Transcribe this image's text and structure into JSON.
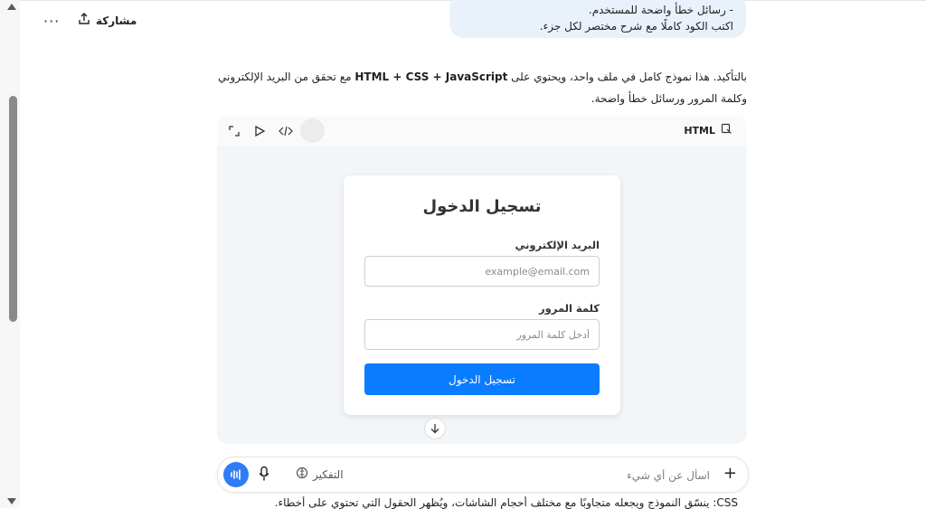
{
  "header": {
    "share_label": "مشاركة",
    "more_label": "···"
  },
  "user_message": {
    "line1": "- رسائل خطأ واضحة للمستخدم.",
    "line2": "اكتب الكود كاملًا مع شرح مختصر لكل جزء."
  },
  "assistant": {
    "intro_part1": "بالتأكيد. هذا نموذج كامل في ملف واحد، ويحتوي على ",
    "intro_tech": "HTML + CSS + JavaScript",
    "intro_part2": " مع تحقق من البريد الإلكتروني وكلمة المرور ورسائل خطأ واضحة."
  },
  "code_card": {
    "language_label": "HTML"
  },
  "login_form": {
    "title": "تسجيل الدخول",
    "email_label": "البريد الإلكتروني",
    "email_placeholder": "example@email.com",
    "password_label": "كلمة المرور",
    "password_placeholder": "أدخل كلمة المرور",
    "submit_label": "تسجيل الدخول"
  },
  "partial_list": {
    "bullet_text": "CSS: ينسّق النموذج ويجعله متجاوبًا مع مختلف أحجام الشاشات، ويُظهر الحقول التي تحتوي على أخطاء."
  },
  "composer": {
    "placeholder": "اسأل عن أي شيء",
    "think_label": "التفكير",
    "plus_label": "+"
  },
  "icons": {
    "share": "share-icon",
    "expand": "expand-icon",
    "play": "play-icon",
    "code": "code-icon",
    "copy": "copy-icon",
    "arrow_down": "arrow-down-icon",
    "mic": "mic-icon",
    "voice": "voice-waveform-icon",
    "think": "think-icon"
  },
  "colors": {
    "primary_button": "#0a7cff",
    "user_bubble": "#e9f1fb",
    "voice_button": "#2f7cf6"
  }
}
